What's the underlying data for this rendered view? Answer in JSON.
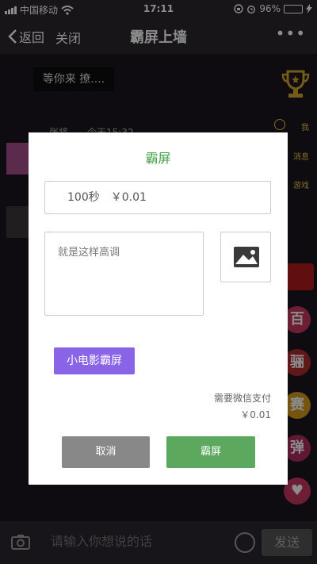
{
  "status_bar": {
    "carrier": "中国移动",
    "time": "17:11",
    "battery": "96%",
    "battery_level": 0.96
  },
  "nav": {
    "back_label": "返回",
    "close_label": "关闭",
    "title": "霸屏上墙",
    "more": "•••"
  },
  "background": {
    "bubble_text": "等你来 撩....",
    "chat_name": "张将",
    "chat_time": "今天15:32",
    "side_items": [
      "我",
      "消息",
      "游戏"
    ],
    "side_circles": [
      "百",
      "骊",
      "赛",
      "弹"
    ]
  },
  "modal": {
    "title": "霸屏",
    "price_option": "100秒　￥0.01",
    "message_text": "就是这样高调",
    "movie_button": "小电影霸屏",
    "pay_note": "需要微信支付",
    "pay_amount": "￥0.01",
    "cancel_button": "取消",
    "confirm_button": "霸屏"
  },
  "bottom_bar": {
    "input_placeholder": "请输入你想说的话",
    "send_button": "发送"
  },
  "colors": {
    "accent_green": "#43a047",
    "button_green": "#5ba85e",
    "button_purple": "#8a64e6",
    "button_gray": "#888888"
  }
}
